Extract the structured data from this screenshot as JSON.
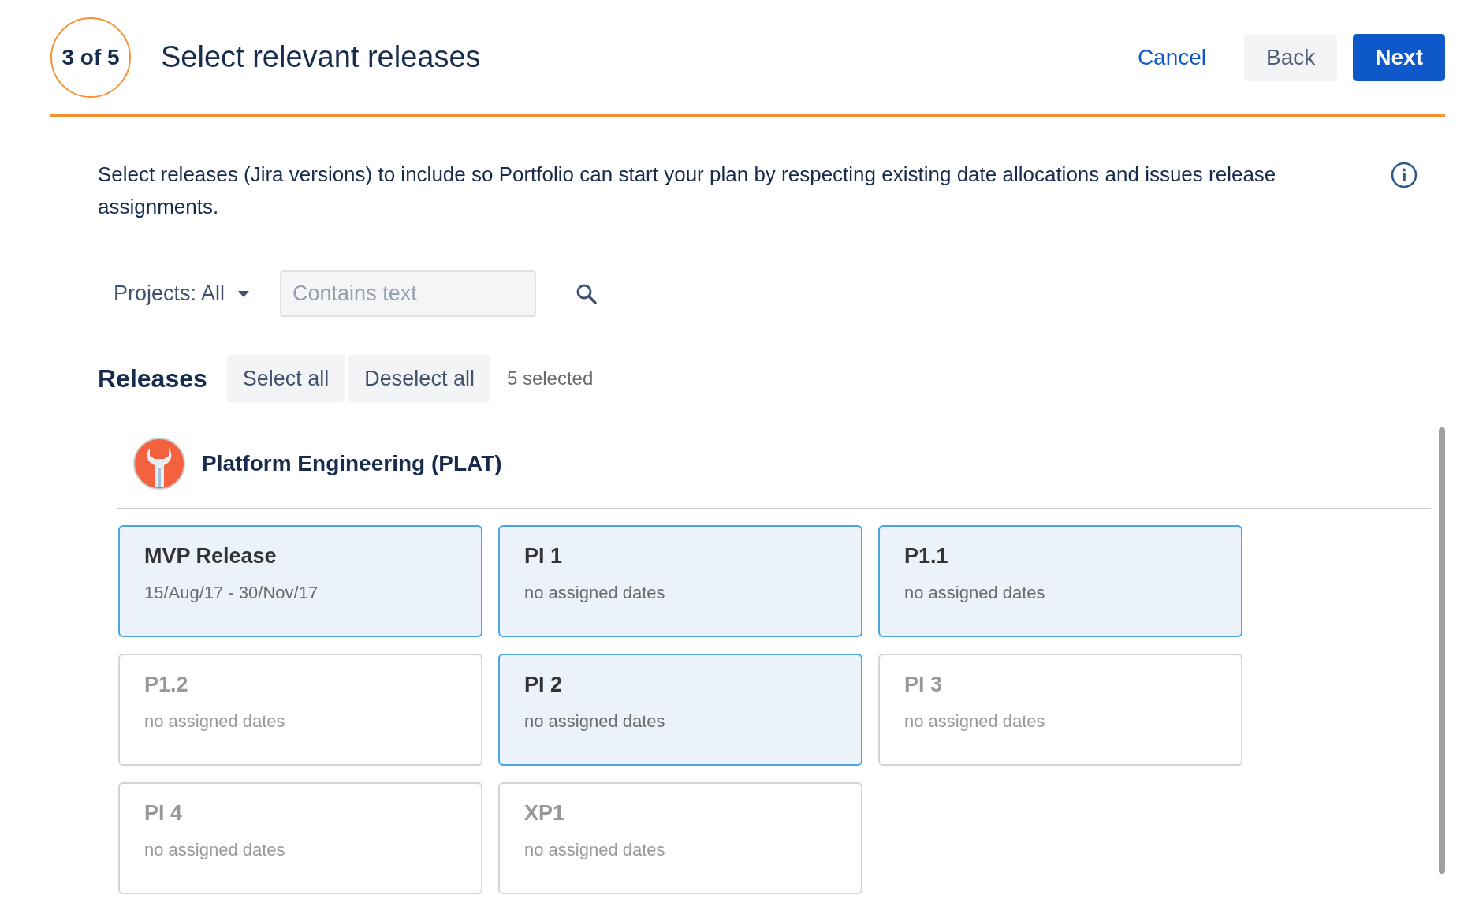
{
  "header": {
    "step": "3 of 5",
    "title": "Select relevant releases",
    "buttons": [
      {
        "kind": "link",
        "label": "Cancel"
      },
      {
        "kind": "subtle",
        "label": "Back"
      },
      {
        "kind": "primary",
        "label": "Next"
      }
    ]
  },
  "description": "Select releases (Jira versions) to include so Portfolio can start your plan by respecting existing date allocations and issues release assignments.",
  "filters": {
    "projects": "Projects: All",
    "search": {
      "placeholder": "Contains text"
    }
  },
  "releases": {
    "title": "Releases",
    "actions": [
      "Select all",
      "Deselect all"
    ],
    "count": "5 selected"
  },
  "project": {
    "name": "Platform Engineering (PLAT)",
    "cards": [
      {
        "name": "MVP Release",
        "dates": "15/Aug/17 - 30/Nov/17",
        "selected": true
      },
      {
        "name": "PI 1",
        "dates": "no assigned dates",
        "selected": true
      },
      {
        "name": "P1.1",
        "dates": "no assigned dates",
        "selected": true
      },
      {
        "name": "P1.2",
        "dates": "no assigned dates",
        "selected": false
      },
      {
        "name": "PI 2",
        "dates": "no assigned dates",
        "selected": true
      },
      {
        "name": "PI 3",
        "dates": "no assigned dates",
        "selected": false
      },
      {
        "name": "PI 4",
        "dates": "no assigned dates",
        "selected": false
      },
      {
        "name": "XP1",
        "dates": "no assigned dates",
        "selected": false
      }
    ]
  }
}
